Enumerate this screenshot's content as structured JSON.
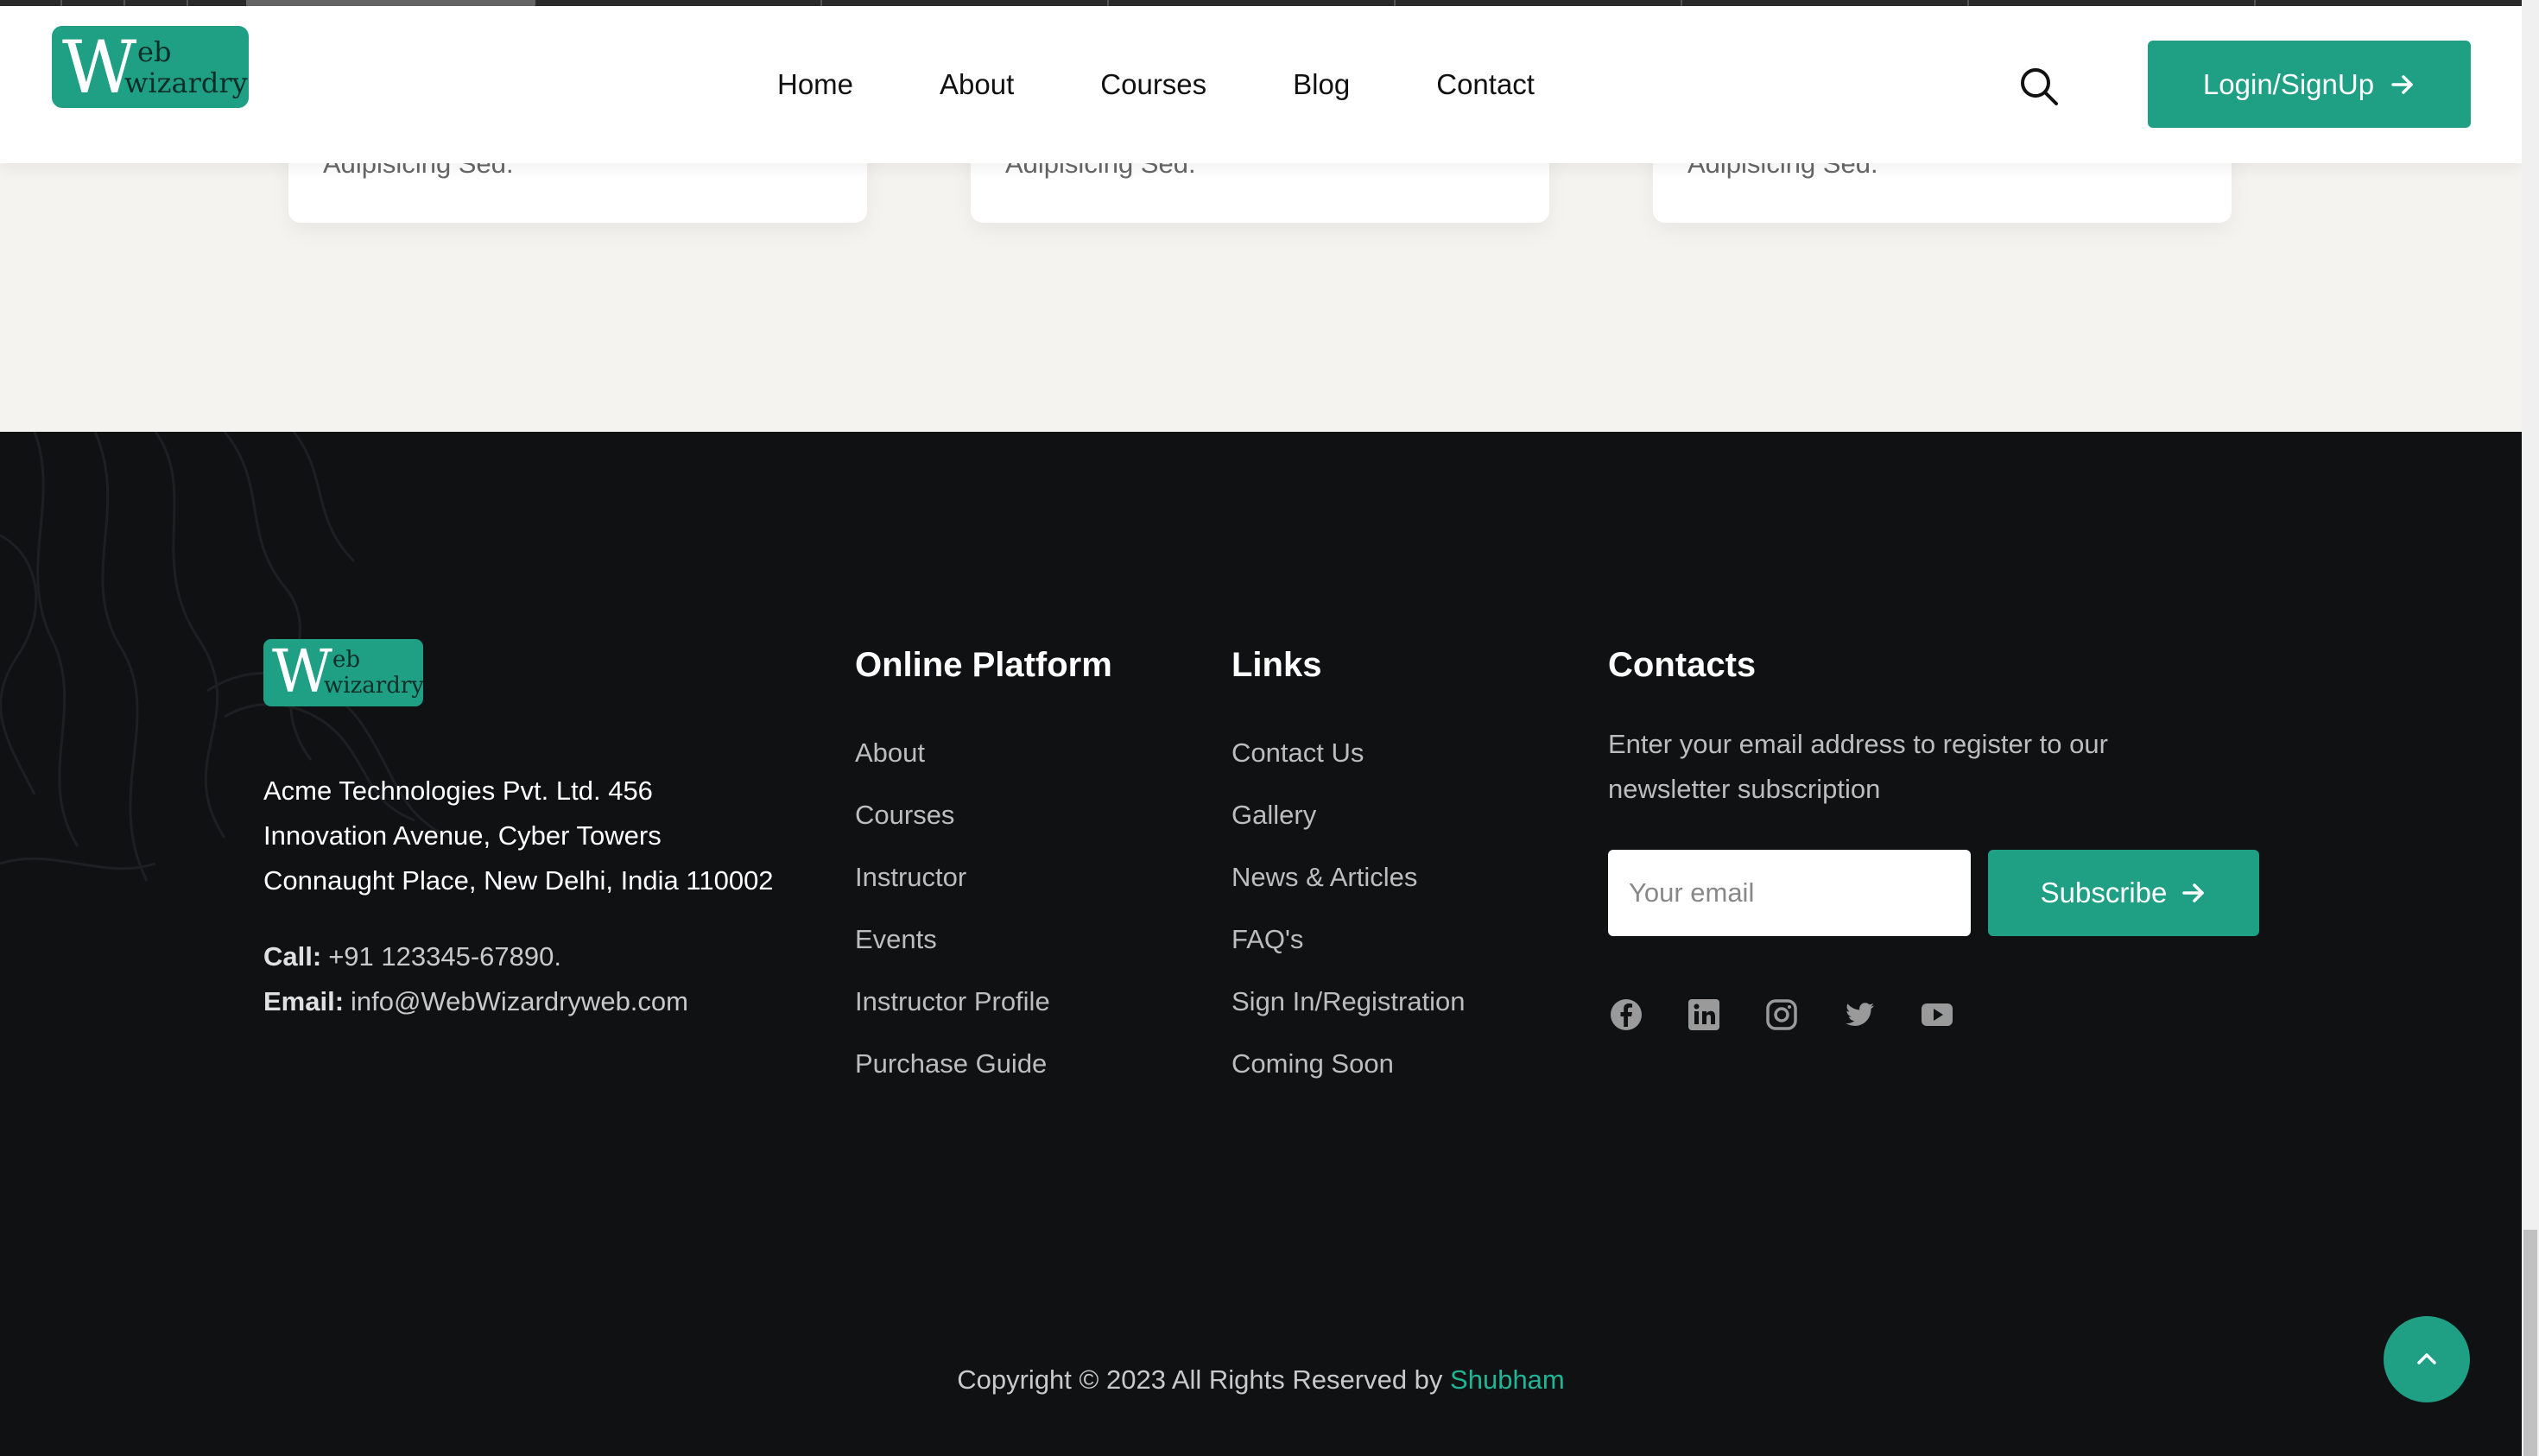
{
  "header": {
    "logo": {
      "big": "W",
      "top": "eb",
      "bottom": "wizardry"
    },
    "nav": [
      "Home",
      "About",
      "Courses",
      "Blog",
      "Contact"
    ],
    "search_icon": "search-icon",
    "login_label": "Login/SignUp",
    "login_icon": "arrow-right-icon"
  },
  "cards": [
    {
      "text": "Adipisicing Sed."
    },
    {
      "text": "Adipisicing Sed."
    },
    {
      "text": "Adipisicing Sed."
    }
  ],
  "footer": {
    "logo": {
      "big": "W",
      "top": "eb",
      "bottom": "wizardry"
    },
    "address": [
      "Acme Technologies Pvt. Ltd. 456",
      "Innovation Avenue, Cyber Towers",
      "Connaught Place, New Delhi, India 110002"
    ],
    "call_label": "Call:",
    "call_value": "+91 123345-67890.",
    "email_label": "Email:",
    "email_value": "info@WebWizardryweb.com",
    "online_platform": {
      "title": "Online Platform",
      "items": [
        "About",
        "Courses",
        "Instructor",
        "Events",
        "Instructor Profile",
        "Purchase Guide"
      ]
    },
    "links": {
      "title": "Links",
      "items": [
        "Contact Us",
        "Gallery",
        "News & Articles",
        "FAQ's",
        "Sign In/Registration",
        "Coming Soon"
      ]
    },
    "contacts": {
      "title": "Contacts",
      "text": "Enter your email address to register to our newsletter subscription",
      "email_placeholder": "Your email",
      "subscribe_label": "Subscribe",
      "socials": [
        "facebook-icon",
        "linkedin-icon",
        "instagram-icon",
        "twitter-icon",
        "youtube-icon"
      ]
    },
    "copyright_text": "Copyright © 2023 All Rights Reserved by",
    "copyright_author": "Shubham"
  },
  "colors": {
    "brand": "#1f9f84",
    "footer_bg": "#0f1112",
    "page_bg": "#f5f3ef",
    "author_link": "#1fb596"
  }
}
